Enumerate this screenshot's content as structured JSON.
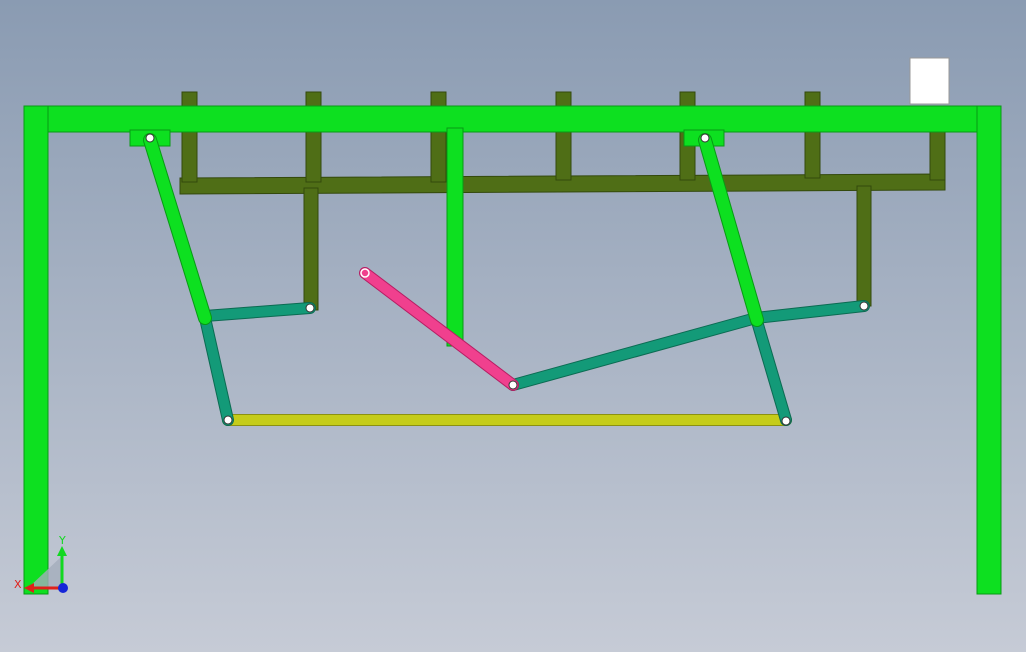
{
  "scene": {
    "background_top": "#8a9bb2",
    "background_bottom": "#c6cbd6"
  },
  "colors": {
    "frame": "#0de020",
    "frame_dark": "#089a14",
    "rail": "#4f6e16",
    "rail_dark": "#33490c",
    "link_teal": "#139a78",
    "link_teal_dark": "#0b6b52",
    "crank_pink": "#f0408e",
    "crank_dark": "#b51e63",
    "coupler_yellow": "#c5cc1a",
    "coupler_dark": "#8c9110",
    "hinge_fill": "#ffffff",
    "square_fill": "#ffffff",
    "square_stroke": "#999999"
  },
  "triad": {
    "x_label": "X",
    "y_label": "Y",
    "x_color": "#e0201a",
    "y_color": "#12d820",
    "z_color": "#1626d8"
  }
}
